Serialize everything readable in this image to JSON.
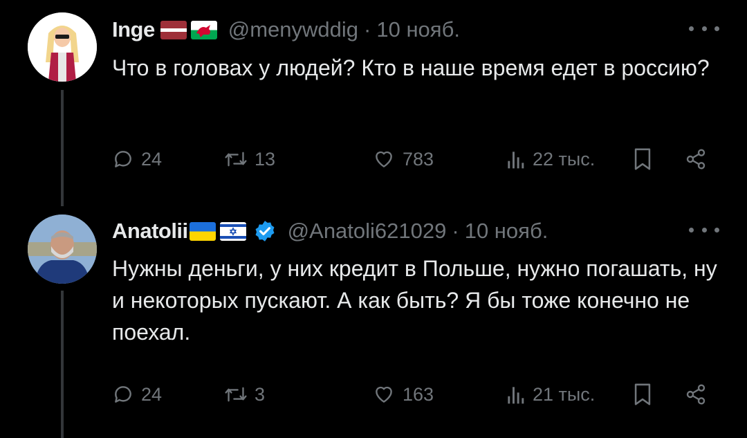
{
  "tweets": [
    {
      "name": "Inge",
      "handle": "@menywddig",
      "separator": "·",
      "date": "10 нояб.",
      "text": "Что в головах у людей? Кто в наше время едет в россию?",
      "flags": [
        "latvia-flag",
        "wales-flag"
      ],
      "verified": false,
      "stats": {
        "replies": "24",
        "retweets": "13",
        "likes": "783",
        "views": "22 тыс."
      }
    },
    {
      "name": "Anatolii",
      "handle": "@Anatoli621029",
      "separator": "·",
      "date": "10 нояб.",
      "text": "Нужны деньги, у них кредит в Польше, нужно погашать, ну и некоторых пускают. А как быть? Я бы тоже конечно не поехал.",
      "flags": [
        "ukraine-flag",
        "israel-flag"
      ],
      "verified": true,
      "stats": {
        "replies": "24",
        "retweets": "3",
        "likes": "163",
        "views": "21 тыс."
      }
    }
  ],
  "colors": {
    "background": "#000000",
    "text_primary": "#e7e9ea",
    "text_secondary": "#71767b",
    "thread_line": "#333639",
    "verified": "#1d9bf0"
  },
  "icons": [
    "reply-icon",
    "retweet-icon",
    "like-icon",
    "views-icon",
    "bookmark-icon",
    "share-icon",
    "more-icon",
    "verified-icon"
  ]
}
